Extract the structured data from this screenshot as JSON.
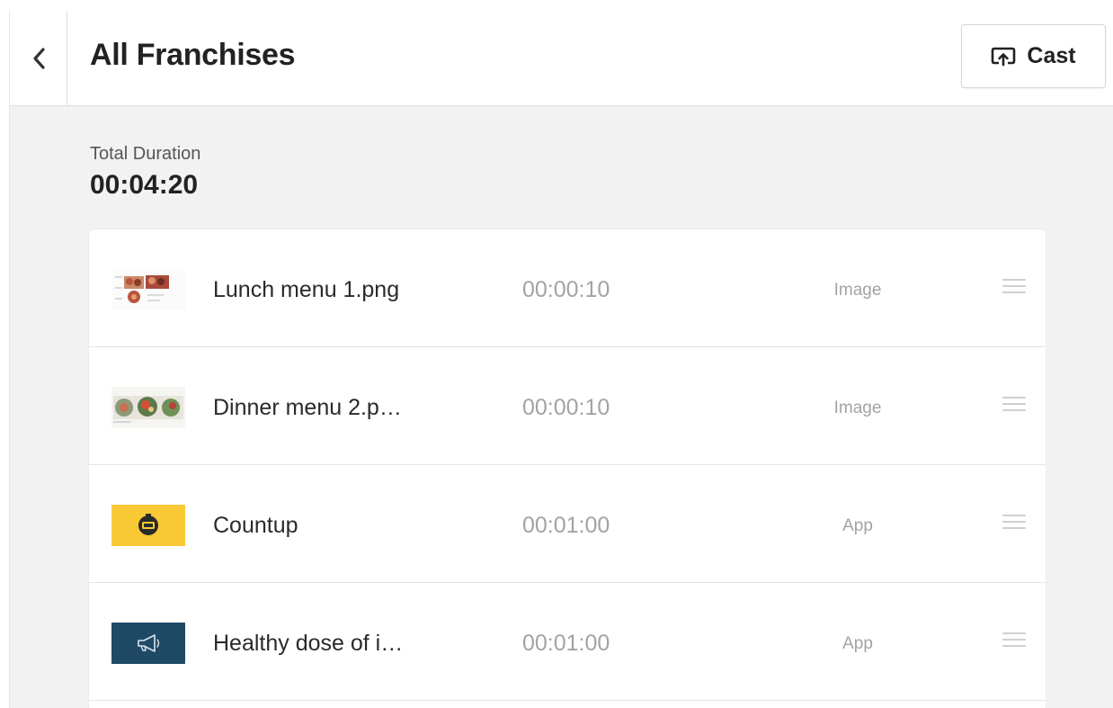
{
  "header": {
    "title": "All Franchises",
    "cast_label": "Cast"
  },
  "summary": {
    "label": "Total Duration",
    "value": "00:04:20"
  },
  "items": [
    {
      "name": "Lunch menu 1.png",
      "duration": "00:00:10",
      "type": "Image",
      "thumb": "food-image-thumbnail"
    },
    {
      "name": "Dinner menu 2.p…",
      "duration": "00:00:10",
      "type": "Image",
      "thumb": "food-image-thumbnail"
    },
    {
      "name": "Countup",
      "duration": "00:01:00",
      "type": "App",
      "thumb": "clock-icon"
    },
    {
      "name": "Healthy dose of i…",
      "duration": "00:01:00",
      "type": "App",
      "thumb": "megaphone-icon"
    }
  ],
  "colors": {
    "background": "#f2f2f2",
    "countup_thumb": "#f9c935",
    "healthy_thumb": "#1f4a66",
    "muted_text": "#a3a3a3"
  }
}
